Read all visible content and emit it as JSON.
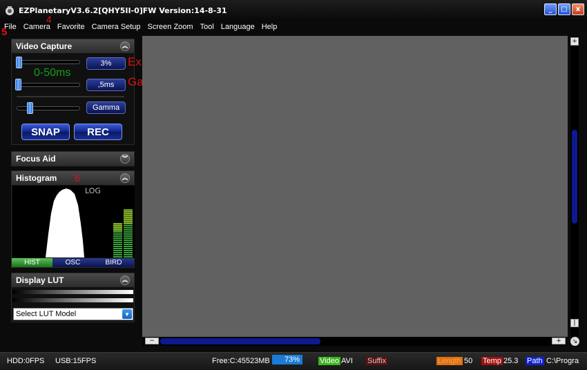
{
  "window": {
    "title": "EZPlanetaryV3.6.2[QHY5II-0]FW Version:14-8-31",
    "buttons": [
      "_",
      "□",
      "x"
    ]
  },
  "menu": [
    "File",
    "Camera",
    "Favorite",
    "Camera Setup",
    "Screen Zoom",
    "Tool",
    "Language",
    "Help"
  ],
  "annotations": {
    "marker_4": "4",
    "marker_5": "5",
    "marker_6": "6",
    "exposure_label": "Exposure Length",
    "gain_label": "Gain"
  },
  "video_capture": {
    "title": "Video Capture",
    "range_label": "0-50ms",
    "exposure_value": "3%",
    "gain_value": ",5ms",
    "gamma_label": "Gamma",
    "snap_label": "SNAP",
    "rec_label": "REC",
    "collapse_icon": "chevron-up-icon"
  },
  "focus_aid": {
    "title": "Focus Aid",
    "collapse_icon": "chevron-down-icon"
  },
  "histogram": {
    "title": "Histogram",
    "log_label": "LOG",
    "tabs": [
      "HIST",
      "OSC",
      "BIRD"
    ],
    "active_tab": "HIST"
  },
  "display_lut": {
    "title": "Display LUT",
    "select_value": "Select LUT Model"
  },
  "status": {
    "hdd": "HDD:0FPS",
    "usb": "USB:15FPS",
    "free": "Free:C:45523MB",
    "usage_percent": "73%",
    "video_tag": "Video",
    "video_format": "AVI",
    "suffix_tag": "Suffix",
    "length_tag": "Length",
    "length_value": "50",
    "temp_tag": "Temp",
    "temp_value": "25.3",
    "path_tag": "Path",
    "path_value": "C:\\Progra"
  },
  "colors": {
    "accent_blue": "#1a2f8e",
    "range_green": "#14a014",
    "annotation_red": "#e01010",
    "image_gray": "#616161",
    "usage_blue": "#1c7bd6",
    "video_green": "#39b51a",
    "suffix_dark": "#5a1010",
    "length_orange": "#e07010",
    "temp_red": "#a01010",
    "path_blue": "#1020d0"
  }
}
